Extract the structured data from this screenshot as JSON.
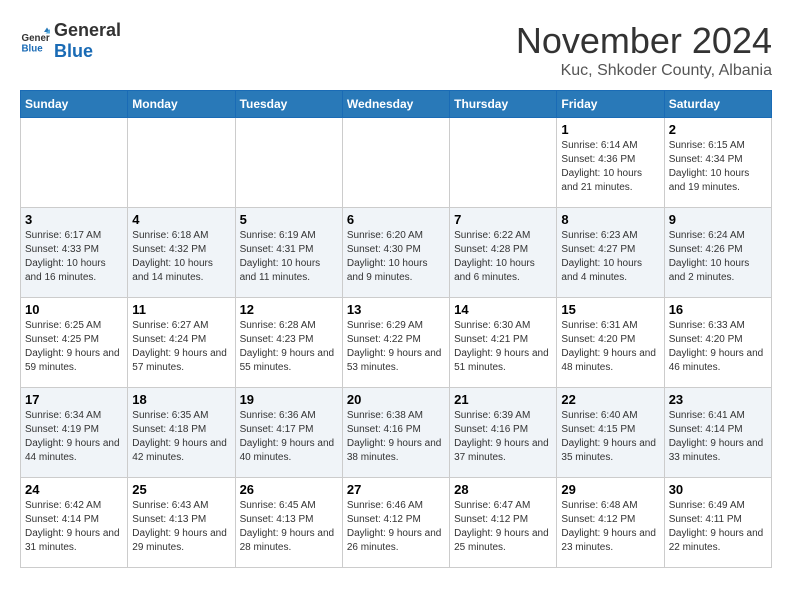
{
  "logo": {
    "general": "General",
    "blue": "Blue"
  },
  "header": {
    "month": "November 2024",
    "location": "Kuc, Shkoder County, Albania"
  },
  "weekdays": [
    "Sunday",
    "Monday",
    "Tuesday",
    "Wednesday",
    "Thursday",
    "Friday",
    "Saturday"
  ],
  "weeks": [
    [
      {
        "day": "",
        "sunrise": "",
        "sunset": "",
        "daylight": ""
      },
      {
        "day": "",
        "sunrise": "",
        "sunset": "",
        "daylight": ""
      },
      {
        "day": "",
        "sunrise": "",
        "sunset": "",
        "daylight": ""
      },
      {
        "day": "",
        "sunrise": "",
        "sunset": "",
        "daylight": ""
      },
      {
        "day": "",
        "sunrise": "",
        "sunset": "",
        "daylight": ""
      },
      {
        "day": "1",
        "sunrise": "Sunrise: 6:14 AM",
        "sunset": "Sunset: 4:36 PM",
        "daylight": "Daylight: 10 hours and 21 minutes."
      },
      {
        "day": "2",
        "sunrise": "Sunrise: 6:15 AM",
        "sunset": "Sunset: 4:34 PM",
        "daylight": "Daylight: 10 hours and 19 minutes."
      }
    ],
    [
      {
        "day": "3",
        "sunrise": "Sunrise: 6:17 AM",
        "sunset": "Sunset: 4:33 PM",
        "daylight": "Daylight: 10 hours and 16 minutes."
      },
      {
        "day": "4",
        "sunrise": "Sunrise: 6:18 AM",
        "sunset": "Sunset: 4:32 PM",
        "daylight": "Daylight: 10 hours and 14 minutes."
      },
      {
        "day": "5",
        "sunrise": "Sunrise: 6:19 AM",
        "sunset": "Sunset: 4:31 PM",
        "daylight": "Daylight: 10 hours and 11 minutes."
      },
      {
        "day": "6",
        "sunrise": "Sunrise: 6:20 AM",
        "sunset": "Sunset: 4:30 PM",
        "daylight": "Daylight: 10 hours and 9 minutes."
      },
      {
        "day": "7",
        "sunrise": "Sunrise: 6:22 AM",
        "sunset": "Sunset: 4:28 PM",
        "daylight": "Daylight: 10 hours and 6 minutes."
      },
      {
        "day": "8",
        "sunrise": "Sunrise: 6:23 AM",
        "sunset": "Sunset: 4:27 PM",
        "daylight": "Daylight: 10 hours and 4 minutes."
      },
      {
        "day": "9",
        "sunrise": "Sunrise: 6:24 AM",
        "sunset": "Sunset: 4:26 PM",
        "daylight": "Daylight: 10 hours and 2 minutes."
      }
    ],
    [
      {
        "day": "10",
        "sunrise": "Sunrise: 6:25 AM",
        "sunset": "Sunset: 4:25 PM",
        "daylight": "Daylight: 9 hours and 59 minutes."
      },
      {
        "day": "11",
        "sunrise": "Sunrise: 6:27 AM",
        "sunset": "Sunset: 4:24 PM",
        "daylight": "Daylight: 9 hours and 57 minutes."
      },
      {
        "day": "12",
        "sunrise": "Sunrise: 6:28 AM",
        "sunset": "Sunset: 4:23 PM",
        "daylight": "Daylight: 9 hours and 55 minutes."
      },
      {
        "day": "13",
        "sunrise": "Sunrise: 6:29 AM",
        "sunset": "Sunset: 4:22 PM",
        "daylight": "Daylight: 9 hours and 53 minutes."
      },
      {
        "day": "14",
        "sunrise": "Sunrise: 6:30 AM",
        "sunset": "Sunset: 4:21 PM",
        "daylight": "Daylight: 9 hours and 51 minutes."
      },
      {
        "day": "15",
        "sunrise": "Sunrise: 6:31 AM",
        "sunset": "Sunset: 4:20 PM",
        "daylight": "Daylight: 9 hours and 48 minutes."
      },
      {
        "day": "16",
        "sunrise": "Sunrise: 6:33 AM",
        "sunset": "Sunset: 4:20 PM",
        "daylight": "Daylight: 9 hours and 46 minutes."
      }
    ],
    [
      {
        "day": "17",
        "sunrise": "Sunrise: 6:34 AM",
        "sunset": "Sunset: 4:19 PM",
        "daylight": "Daylight: 9 hours and 44 minutes."
      },
      {
        "day": "18",
        "sunrise": "Sunrise: 6:35 AM",
        "sunset": "Sunset: 4:18 PM",
        "daylight": "Daylight: 9 hours and 42 minutes."
      },
      {
        "day": "19",
        "sunrise": "Sunrise: 6:36 AM",
        "sunset": "Sunset: 4:17 PM",
        "daylight": "Daylight: 9 hours and 40 minutes."
      },
      {
        "day": "20",
        "sunrise": "Sunrise: 6:38 AM",
        "sunset": "Sunset: 4:16 PM",
        "daylight": "Daylight: 9 hours and 38 minutes."
      },
      {
        "day": "21",
        "sunrise": "Sunrise: 6:39 AM",
        "sunset": "Sunset: 4:16 PM",
        "daylight": "Daylight: 9 hours and 37 minutes."
      },
      {
        "day": "22",
        "sunrise": "Sunrise: 6:40 AM",
        "sunset": "Sunset: 4:15 PM",
        "daylight": "Daylight: 9 hours and 35 minutes."
      },
      {
        "day": "23",
        "sunrise": "Sunrise: 6:41 AM",
        "sunset": "Sunset: 4:14 PM",
        "daylight": "Daylight: 9 hours and 33 minutes."
      }
    ],
    [
      {
        "day": "24",
        "sunrise": "Sunrise: 6:42 AM",
        "sunset": "Sunset: 4:14 PM",
        "daylight": "Daylight: 9 hours and 31 minutes."
      },
      {
        "day": "25",
        "sunrise": "Sunrise: 6:43 AM",
        "sunset": "Sunset: 4:13 PM",
        "daylight": "Daylight: 9 hours and 29 minutes."
      },
      {
        "day": "26",
        "sunrise": "Sunrise: 6:45 AM",
        "sunset": "Sunset: 4:13 PM",
        "daylight": "Daylight: 9 hours and 28 minutes."
      },
      {
        "day": "27",
        "sunrise": "Sunrise: 6:46 AM",
        "sunset": "Sunset: 4:12 PM",
        "daylight": "Daylight: 9 hours and 26 minutes."
      },
      {
        "day": "28",
        "sunrise": "Sunrise: 6:47 AM",
        "sunset": "Sunset: 4:12 PM",
        "daylight": "Daylight: 9 hours and 25 minutes."
      },
      {
        "day": "29",
        "sunrise": "Sunrise: 6:48 AM",
        "sunset": "Sunset: 4:12 PM",
        "daylight": "Daylight: 9 hours and 23 minutes."
      },
      {
        "day": "30",
        "sunrise": "Sunrise: 6:49 AM",
        "sunset": "Sunset: 4:11 PM",
        "daylight": "Daylight: 9 hours and 22 minutes."
      }
    ]
  ]
}
